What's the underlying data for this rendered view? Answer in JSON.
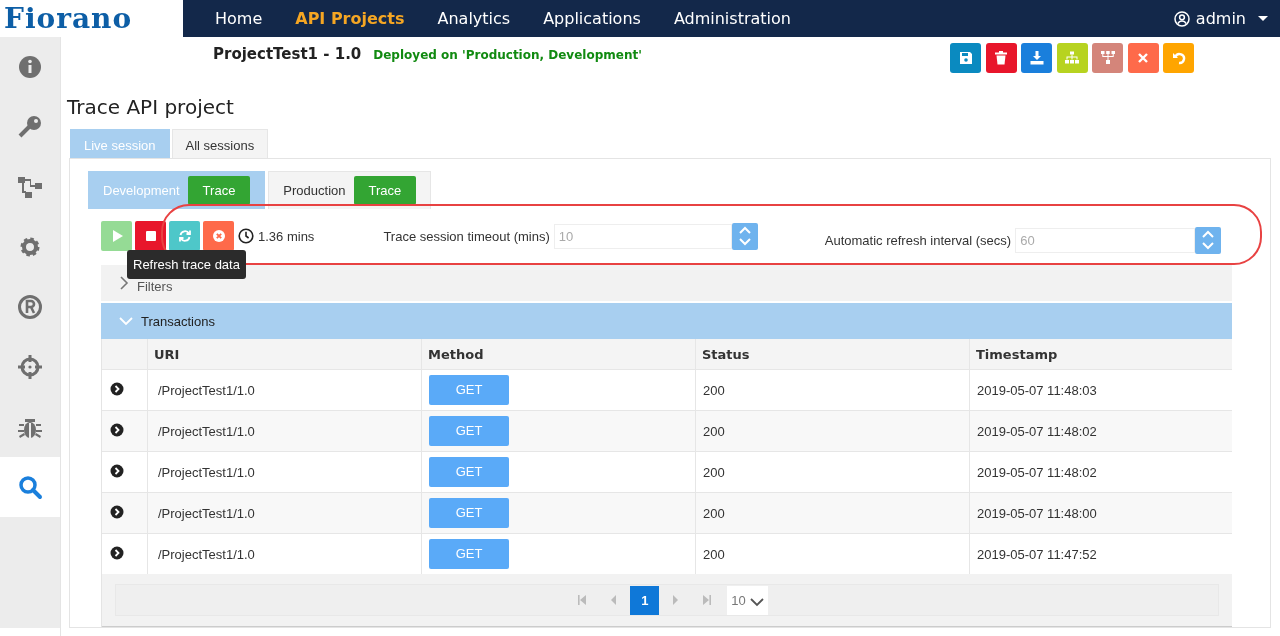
{
  "brand": {
    "logo": "Fiorano"
  },
  "nav": {
    "items": [
      {
        "label": "Home",
        "selected": false
      },
      {
        "label": "API Projects",
        "selected": true
      },
      {
        "label": "Analytics",
        "selected": false
      },
      {
        "label": "Applications",
        "selected": false
      },
      {
        "label": "Administration",
        "selected": false
      }
    ],
    "user": "admin"
  },
  "sidebar": {
    "items": [
      {
        "kind": "info",
        "selected": false
      },
      {
        "kind": "key",
        "selected": false
      },
      {
        "kind": "flow",
        "selected": false
      },
      {
        "kind": "gear",
        "selected": false
      },
      {
        "kind": "registered",
        "selected": false
      },
      {
        "kind": "crosshair",
        "selected": false
      },
      {
        "kind": "bug",
        "selected": false
      },
      {
        "kind": "search",
        "selected": true
      }
    ]
  },
  "header": {
    "project": "ProjectTest1 - 1.0",
    "status": "Deployed on 'Production, Development'"
  },
  "toolbar_buttons": [
    {
      "kind": "save"
    },
    {
      "kind": "delete"
    },
    {
      "kind": "download"
    },
    {
      "kind": "sitemap"
    },
    {
      "kind": "hierarchy"
    },
    {
      "kind": "close"
    },
    {
      "kind": "undo"
    }
  ],
  "page_title": "Trace API project",
  "session_tabs": [
    {
      "label": "Live session",
      "selected": true
    },
    {
      "label": "All sessions",
      "selected": false
    }
  ],
  "env_tabs": [
    {
      "label": "Development",
      "action": "Trace",
      "selected": true
    },
    {
      "label": "Production",
      "action": "Trace",
      "selected": false
    }
  ],
  "controls": {
    "buttons": [
      {
        "kind": "play",
        "disabled": true
      },
      {
        "kind": "stop",
        "disabled": false
      },
      {
        "kind": "refresh",
        "disabled": false
      },
      {
        "kind": "clear",
        "disabled": false
      }
    ],
    "elapsed": "1.36 mins",
    "tooltip": "Refresh trace data",
    "timeout": {
      "label": "Trace session timeout (mins)",
      "placeholder": "10"
    },
    "refresh_interval": {
      "label": "Automatic refresh interval (secs)",
      "placeholder": "60"
    }
  },
  "filters": {
    "label": "Filters",
    "expanded": false
  },
  "transactions": {
    "label": "Transactions",
    "expanded": true,
    "columns": [
      "URI",
      "Method",
      "Status",
      "Timestamp"
    ],
    "rows": [
      {
        "uri": "/ProjectTest1/1.0",
        "method": "GET",
        "status": "200",
        "timestamp": "2019-05-07 11:48:03"
      },
      {
        "uri": "/ProjectTest1/1.0",
        "method": "GET",
        "status": "200",
        "timestamp": "2019-05-07 11:48:02"
      },
      {
        "uri": "/ProjectTest1/1.0",
        "method": "GET",
        "status": "200",
        "timestamp": "2019-05-07 11:48:02"
      },
      {
        "uri": "/ProjectTest1/1.0",
        "method": "GET",
        "status": "200",
        "timestamp": "2019-05-07 11:48:00"
      },
      {
        "uri": "/ProjectTest1/1.0",
        "method": "GET",
        "status": "200",
        "timestamp": "2019-05-07 11:47:52"
      }
    ]
  },
  "pager": {
    "pages": [
      {
        "label": "1",
        "selected": true
      }
    ],
    "page_size": "10"
  }
}
